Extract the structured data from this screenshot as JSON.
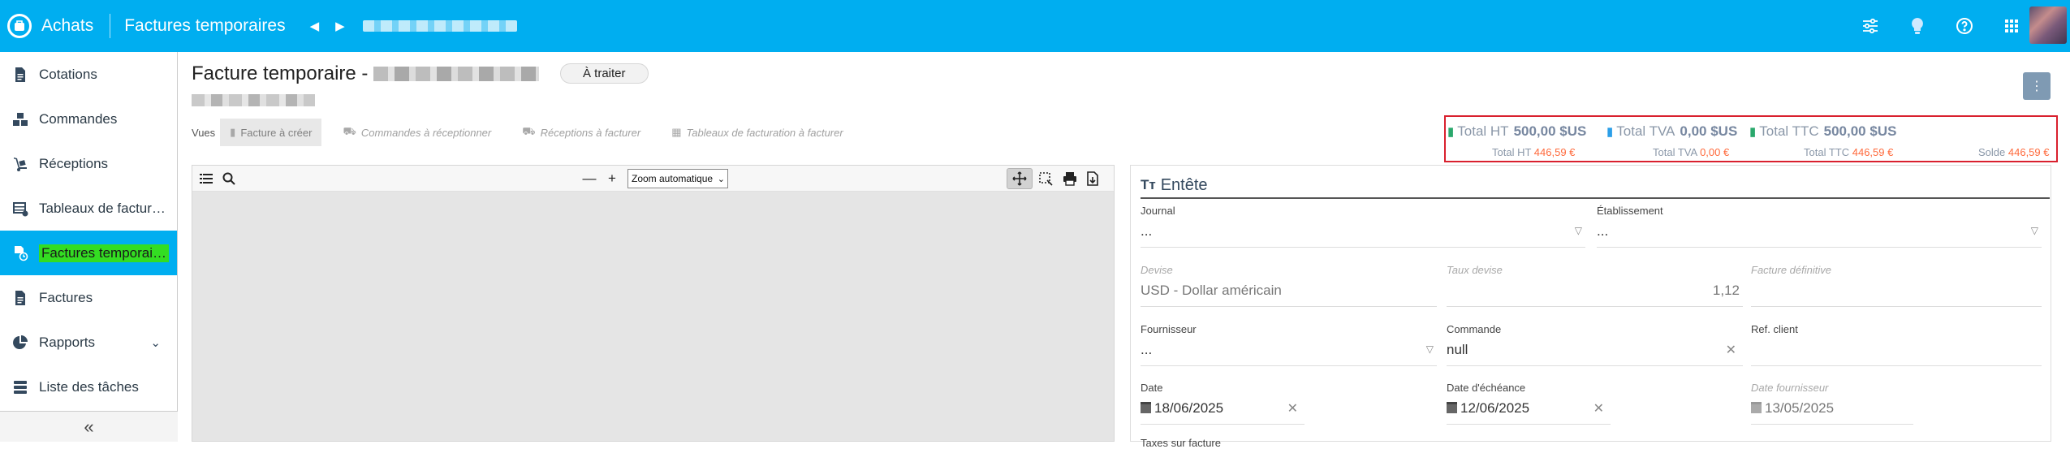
{
  "topbar": {
    "app_name": "Achats",
    "page_name": "Factures temporaires",
    "icons": [
      "sliders-icon",
      "lightbulb-icon",
      "help-circle-icon",
      "apps-grid-icon"
    ]
  },
  "sidebar": {
    "items": [
      {
        "label": "Cotations",
        "icon": "document-icon"
      },
      {
        "label": "Commandes",
        "icon": "boxes-icon"
      },
      {
        "label": "Réceptions",
        "icon": "dolly-icon"
      },
      {
        "label": "Tableaux de factur…",
        "icon": "table-icon"
      },
      {
        "label": "Factures temporai…",
        "icon": "doc-clock-icon"
      },
      {
        "label": "Factures",
        "icon": "document-icon"
      },
      {
        "label": "Rapports",
        "icon": "chart-pie-icon"
      },
      {
        "label": "Liste des tâches",
        "icon": "tasks-icon"
      }
    ],
    "collapse": "«"
  },
  "header": {
    "title": "Facture temporaire -",
    "status": "À traiter",
    "kebab": "⋮"
  },
  "views": {
    "label": "Vues",
    "tabs": [
      {
        "label": "Facture à créer"
      },
      {
        "label": "Commandes à réceptionner"
      },
      {
        "label": "Réceptions à facturer"
      },
      {
        "label": "Tableaux de facturation à facturer"
      }
    ]
  },
  "totals": {
    "ht_label": "Total HT",
    "ht_value": "500,00 $US",
    "tva_label": "Total TVA",
    "tva_value": "0,00 $US",
    "ttc_label": "Total TTC",
    "ttc_value": "500,00 $US",
    "sub_ht_label": "Total HT",
    "sub_ht_value": "446,59 €",
    "sub_tva_label": "Total TVA",
    "sub_tva_value": "0,00 €",
    "sub_ttc_label": "Total TTC",
    "sub_ttc_value": "446,59 €",
    "solde_label": "Solde",
    "solde_value": "446,59 €"
  },
  "viewer": {
    "zoom_value": "Zoom automatique",
    "minus": "—",
    "plus": "+"
  },
  "form": {
    "section_title": "Entête",
    "section_icon": "Tт",
    "journal_label": "Journal",
    "journal_value": "...",
    "etablissement_label": "Établissement",
    "etablissement_value": "...",
    "devise_label": "Devise",
    "devise_value": "USD - Dollar américain",
    "taux_label": "Taux devise",
    "taux_value": "1,12",
    "definitive_label": "Facture définitive",
    "fournisseur_label": "Fournisseur",
    "fournisseur_value": "...",
    "commande_label": "Commande",
    "commande_value": "null",
    "refclient_label": "Ref. client",
    "date_label": "Date",
    "date_value": "18/06/2025",
    "echeance_label": "Date d'échéance",
    "echeance_value": "12/06/2025",
    "datefourn_label": "Date fournisseur",
    "datefourn_value": "13/05/2025",
    "bottom_cut": "Taxes sur facture"
  }
}
